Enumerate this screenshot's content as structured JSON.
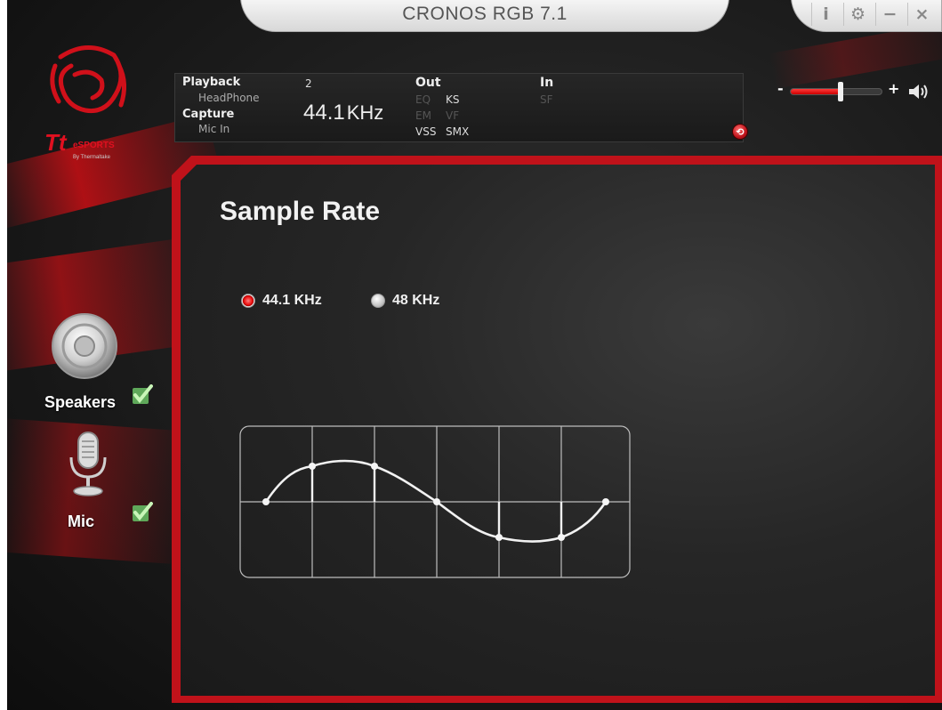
{
  "window": {
    "title": "CRONOS RGB 7.1",
    "controls": [
      "i",
      "⚙",
      "−",
      "×"
    ]
  },
  "logo": {
    "brand": "Tt eSPORTS",
    "tagline": "By Thermaltake"
  },
  "info": {
    "playback_label": "Playback",
    "playback_device": "HeadPhone",
    "capture_label": "Capture",
    "capture_device": "Mic In",
    "channels": "2",
    "rate": "44.1",
    "rate_unit": "KHz",
    "out_label": "Out",
    "out_eq": "EQ",
    "out_ks": "KS",
    "out_em": "EM",
    "out_vf": "VF",
    "out_vss": "VSS",
    "out_smx": "SMX",
    "in_label": "In",
    "in_sf": "SF"
  },
  "volume": {
    "minus": "-",
    "plus": "+",
    "level": 0.55
  },
  "sidebar": {
    "items": [
      {
        "label": "Speakers",
        "enabled": true
      },
      {
        "label": "Mic",
        "enabled": true
      }
    ]
  },
  "main": {
    "title": "Sample Rate",
    "options": [
      {
        "label": "44.1 KHz",
        "selected": true
      },
      {
        "label": "48 KHz",
        "selected": false
      }
    ]
  },
  "colors": {
    "accent": "#c0121a",
    "background": "#1e1e1e",
    "text": "#f0f0f0"
  }
}
